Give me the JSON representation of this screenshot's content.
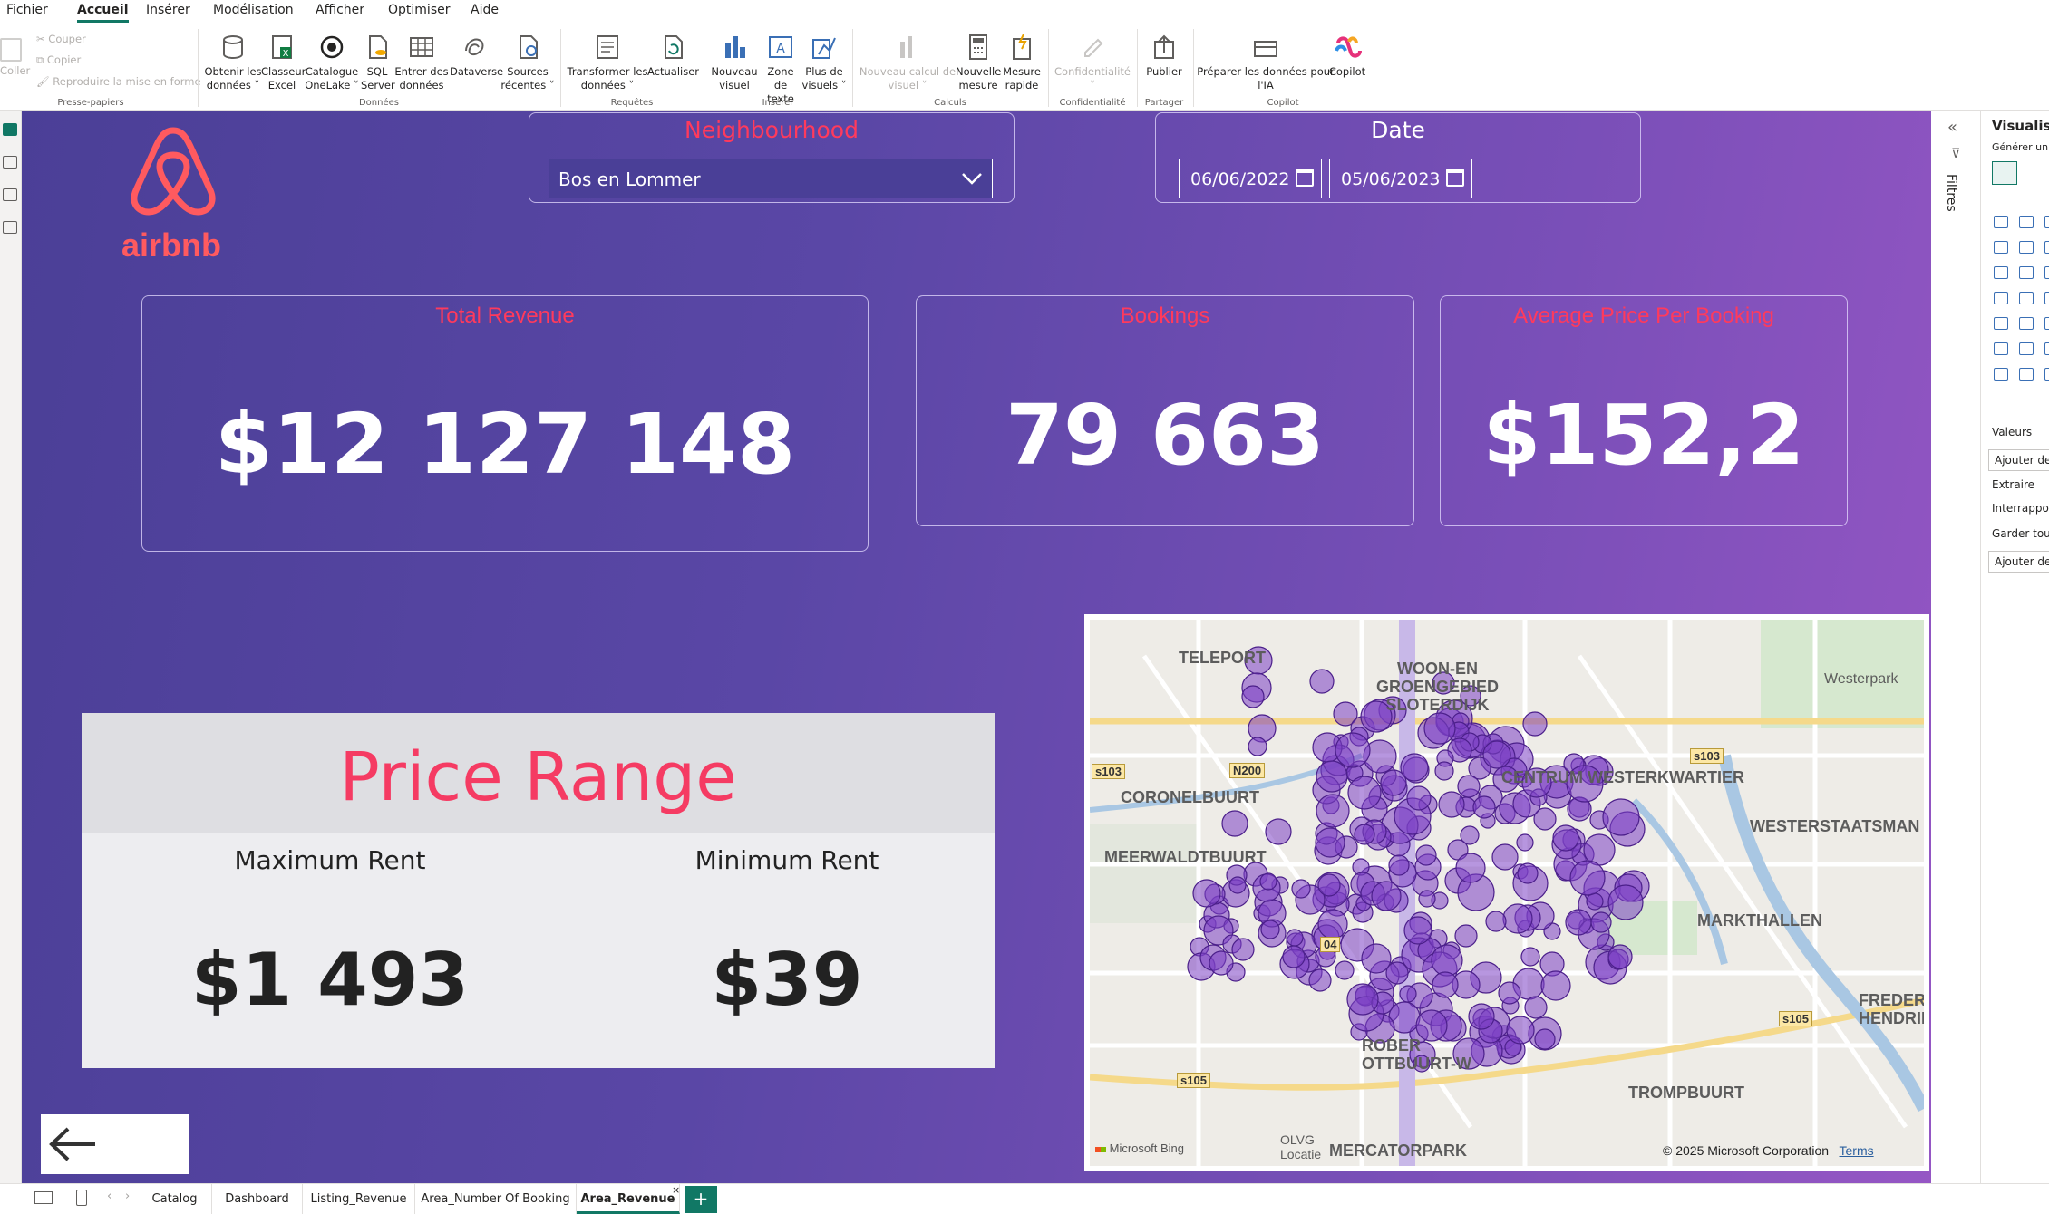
{
  "menu": {
    "items": [
      "Fichier",
      "Accueil",
      "Insérer",
      "Modélisation",
      "Afficher",
      "Optimiser",
      "Aide"
    ]
  },
  "ribbon": {
    "clipboard": {
      "cut": "Couper",
      "copy": "Copier",
      "format": "Reproduire la mise en forme",
      "paste": "Coller",
      "group": "Presse-papiers"
    },
    "data": {
      "get_data": "Obtenir les\ndonnées ˅",
      "excel": "Classeur\nExcel",
      "onelake": "Catalogue\nOneLake ˅",
      "sql": "SQL\nServer",
      "enter": "Entrer des\ndonnées",
      "dataverse": "Dataverse",
      "recent": "Sources\nrécentes ˅",
      "group": "Données"
    },
    "queries": {
      "transform": "Transformer les\ndonnées ˅",
      "refresh": "Actualiser",
      "group": "Requêtes"
    },
    "insert": {
      "new_visual": "Nouveau\nvisuel",
      "text_box": "Zone de\ntexte",
      "more_visuals": "Plus de\nvisuels ˅",
      "group": "Insérer"
    },
    "calc": {
      "new_calc": "Nouveau calcul de\nvisuel ˅",
      "new_measure": "Nouvelle\nmesure",
      "quick_measure": "Mesure\nrapide",
      "group": "Calculs"
    },
    "sensitivity": {
      "label": "Confidentialité\n˅",
      "group": "Confidentialité"
    },
    "share": {
      "publish": "Publier",
      "group": "Partager"
    },
    "copilot": {
      "prepare": "Préparer les données pour\nl'IA",
      "copilot": "Copilot",
      "group": "Copilot"
    }
  },
  "report": {
    "brand": "airbnb",
    "neighbourhood_slicer": {
      "title": "Neighbourhood",
      "selected": "Bos en Lommer"
    },
    "date_slicer": {
      "title": "Date",
      "start": "06/06/2022",
      "end": "05/06/2023"
    },
    "kpis": {
      "total_revenue": {
        "title": "Total Revenue",
        "value": "$12 127 148"
      },
      "bookings": {
        "title": "Bookings",
        "value": "79 663"
      },
      "avg_price": {
        "title": "Average Price Per Booking",
        "value": "$152,2"
      }
    },
    "price_range": {
      "title": "Price Range",
      "max_label": "Maximum Rent",
      "max_value": "$1 493",
      "min_label": "Minimum Rent",
      "min_value": "$39"
    },
    "map": {
      "labels": [
        "TELEPORT",
        "WOON-EN\nGROENGEBIED\nSLOTERDIJK",
        "Westerpark",
        "CORONELBUURT",
        "CENTRUM WESTERKWARTIER",
        "WESTERSTAATSMAN",
        "MEERWALDTBUURT",
        "MARKTHALLEN",
        "FREDER\nHENDRIKBU",
        "ROBER\nOTTBUURT-W",
        "TROMPBUURT",
        "OLVG\nLocatie",
        "MERCATORPARK"
      ],
      "roads": [
        "s103",
        "N200",
        "s103",
        "s105",
        "s105",
        "04"
      ],
      "attribution": "© 2025 Microsoft Corporation",
      "terms": "Terms",
      "provider": "Microsoft Bing",
      "marker_color": "#7b3fc4"
    }
  },
  "right_pane": {
    "filters": "Filtres",
    "visualizations": "Visualisat",
    "generate": "Générer un é",
    "values": "Valeurs",
    "add_data": "Ajouter des",
    "drill": "Extraire",
    "cross_report": "Interrapport",
    "keep_all": "Garder tous",
    "add_drill": "Ajouter des"
  },
  "page_tabs": {
    "tabs": [
      "Catalog",
      "Dashboard",
      "Listing_Revenue",
      "Area_Number Of Booking",
      "Area_Revenue"
    ],
    "active": "Area_Revenue",
    "add": "+"
  }
}
